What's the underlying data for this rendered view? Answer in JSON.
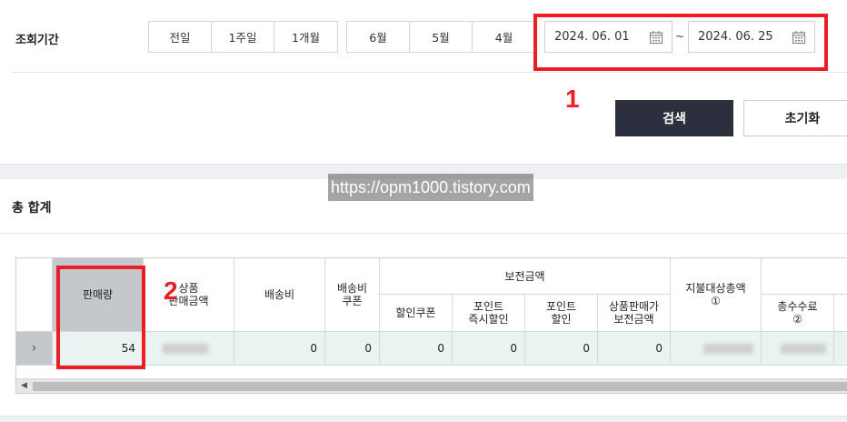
{
  "filter": {
    "period_label": "조회기간",
    "quick_buttons": [
      "전일",
      "1주일",
      "1개월"
    ],
    "month_buttons": [
      "6월",
      "5월",
      "4월"
    ],
    "date_from": "2024. 06. 01",
    "date_to": "2024. 06. 25",
    "separator": "~"
  },
  "actions": {
    "search": "검색",
    "reset": "초기화"
  },
  "annotations": {
    "a1": "1",
    "a2": "2"
  },
  "watermark": "https://opm1000.tistory.com",
  "section": {
    "title": "총 합계"
  },
  "table": {
    "headers": {
      "sales_qty": "판매량",
      "product_sales": "상품\n판매금액",
      "shipping": "배송비",
      "ship_coupon": "배송비\n쿠폰",
      "compensation": "보전금액",
      "discount_coupon": "할인쿠폰",
      "point_instant": "포인트\n즉시할인",
      "point_discount": "포인트\n할인",
      "product_comp": "상품판매가\n보전금액",
      "payout_total": "지불대상총액\n①",
      "total_fee": "총수수료\n②"
    },
    "row": {
      "sales_qty": "54",
      "shipping": "0",
      "ship_coupon": "0",
      "discount_coupon": "0",
      "point_instant": "0",
      "point_discount": "0",
      "product_comp": "0"
    }
  },
  "colors": {
    "highlight": "#ee1c24",
    "primary_button": "#2b2f3e",
    "row_bg": "#e8f3f2"
  }
}
